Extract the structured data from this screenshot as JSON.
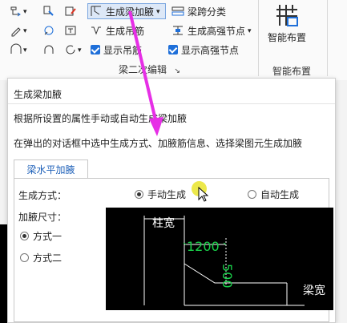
{
  "ribbon": {
    "row1": {
      "generate_haunch": "生成梁加腋",
      "beam_span": "梁跨分类"
    },
    "row2": {
      "generate_hanger": "生成吊筋",
      "generate_high_strength_node": "生成高强节点"
    },
    "row3": {
      "show_hanger": "显示吊筋",
      "show_high_strength_node": "显示高强节点"
    },
    "group_label": "梁二次编辑",
    "smart_layout": "智能布置",
    "smart_layout_group": "智能布置"
  },
  "tooltip": {
    "title": "生成梁加腋",
    "desc1": "根据所设置的属性手动或自动生成梁加腋",
    "desc2": "在弹出的对话框中选中生成方式、加腋筋信息、选择梁图元生成加腋",
    "tab": "梁水平加腋",
    "gen_mode_label": "生成方式：",
    "manual": "手动生成",
    "auto": "自动生成",
    "size_label": "加腋尺寸：",
    "mode1": "方式一",
    "mode2": "方式二",
    "preview": {
      "column_width": "柱宽",
      "dim_h": "1200",
      "dim_v": "500",
      "beam_width": "梁宽"
    }
  },
  "colors": {
    "accent": "#1e6fd9",
    "arrow": "#e62fe6",
    "cad_green": "#19d14a"
  }
}
